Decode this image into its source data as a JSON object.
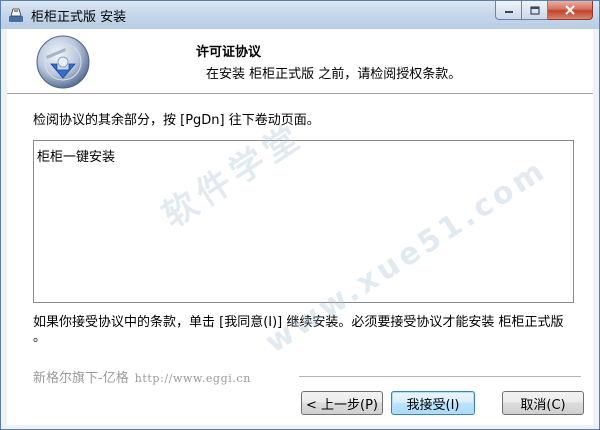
{
  "window": {
    "title": "柜柜正式版 安装"
  },
  "header": {
    "title": "许可证协议",
    "subtitle": "在安装 柜柜正式版  之前，请检阅授权条款。"
  },
  "body": {
    "instruction": "检阅协议的其余部分，按 [PgDn] 往下卷动页面。",
    "license_text": "柜柜一键安装",
    "accept_note": "如果你接受协议中的条款，单击 [我同意(I)] 继续安装。必须要接受协议才能安装 柜柜正式版  。"
  },
  "brand": {
    "name": "新格尔旗下-亿格",
    "url": "http://www.eggi.cn"
  },
  "buttons": {
    "back": "< 上一步(P)",
    "accept": "我接受(I)",
    "cancel": "取消(C)"
  },
  "watermark": {
    "line1": "软件学堂",
    "line2": "www.xue51.com"
  }
}
